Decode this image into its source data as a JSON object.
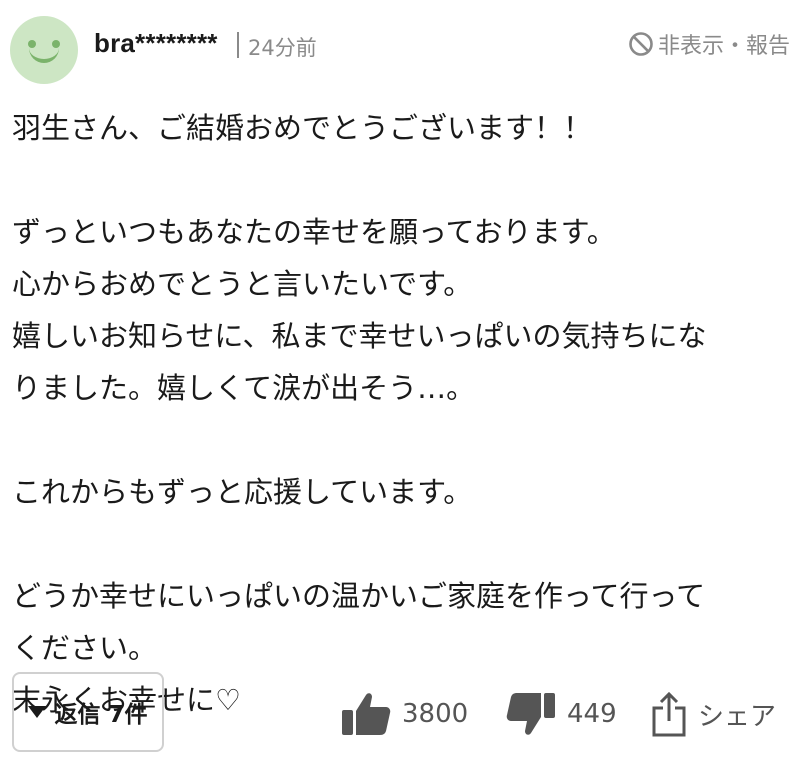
{
  "comment": {
    "user_name": "bra********",
    "time": "24分前",
    "hide_report_label": "非表示・報告",
    "lines": [
      "羽生さん、ご結婚おめでとうございます！！",
      "",
      "ずっといつもあなたの幸せを願っております。",
      "心からおめでとうと言いたいです。",
      "嬉しいお知らせに、私まで幸せいっぱいの気持ちにな",
      "りました。嬉しくて涙が出そう…。",
      "",
      "これからもずっと応援しています。",
      "",
      "どうか幸せにいっぱいの温かいご家庭を作って行って",
      "ください。",
      "末永くお幸せに♡"
    ],
    "replies_label": "返信 7件",
    "like_count": "3800",
    "dislike_count": "449",
    "share_label": "シェア"
  },
  "colors": {
    "avatar_bg": "#cde6c4",
    "avatar_face": "#7bb36b",
    "meta_text": "#8a8a8a",
    "action_icon": "#555555"
  },
  "icons": {
    "avatar": "smiley-avatar-icon",
    "hide": "prohibited-icon",
    "replies_toggle": "triangle-down-icon",
    "like": "thumbs-up-icon",
    "dislike": "thumbs-down-icon",
    "share": "share-icon"
  }
}
